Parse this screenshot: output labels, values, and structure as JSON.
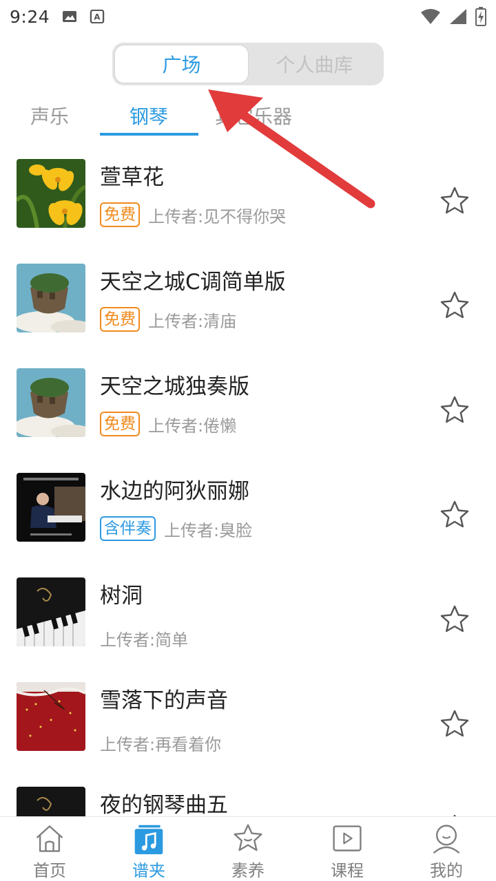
{
  "status_bar": {
    "time": "9:24",
    "left_icons": [
      "image-icon",
      "a-text-icon"
    ],
    "right_icons": [
      "wifi-icon",
      "signal-icon",
      "battery-charging-icon"
    ]
  },
  "segment": {
    "options": [
      "广场",
      "个人曲库"
    ],
    "selected": "广场"
  },
  "category_tabs": {
    "tabs": [
      "声乐",
      "钢琴",
      "其它乐器"
    ],
    "selected": "钢琴"
  },
  "songs": [
    {
      "title": "萱草花",
      "badge": "免费",
      "badge_type": "free",
      "uploader": "上传者:见不得你哭"
    },
    {
      "title": "天空之城C调简单版",
      "badge": "免费",
      "badge_type": "free",
      "uploader": "上传者:清庙"
    },
    {
      "title": "天空之城独奏版",
      "badge": "免费",
      "badge_type": "free",
      "uploader": "上传者:倦懒"
    },
    {
      "title": "水边的阿狄丽娜",
      "badge": "含伴奏",
      "badge_type": "accompaniment",
      "uploader": "上传者:臭脸"
    },
    {
      "title": "树洞",
      "badge": "",
      "badge_type": "none",
      "uploader": "上传者:简单"
    },
    {
      "title": "雪落下的声音",
      "badge": "",
      "badge_type": "none",
      "uploader": "上传者:再看着你"
    },
    {
      "title": "夜的钢琴曲五",
      "badge": "",
      "badge_type": "none",
      "uploader": ""
    }
  ],
  "bottom_nav": {
    "items": [
      {
        "label": "首页",
        "icon": "home-icon"
      },
      {
        "label": "谱夹",
        "icon": "music-folder-icon"
      },
      {
        "label": "素养",
        "icon": "star-smile-icon"
      },
      {
        "label": "课程",
        "icon": "play-video-icon"
      },
      {
        "label": "我的",
        "icon": "profile-icon"
      }
    ],
    "selected": "谱夹"
  },
  "colors": {
    "accent": "#2b9ae0",
    "badge_free": "#f08a1c",
    "annotation_arrow": "#e23b3b"
  }
}
